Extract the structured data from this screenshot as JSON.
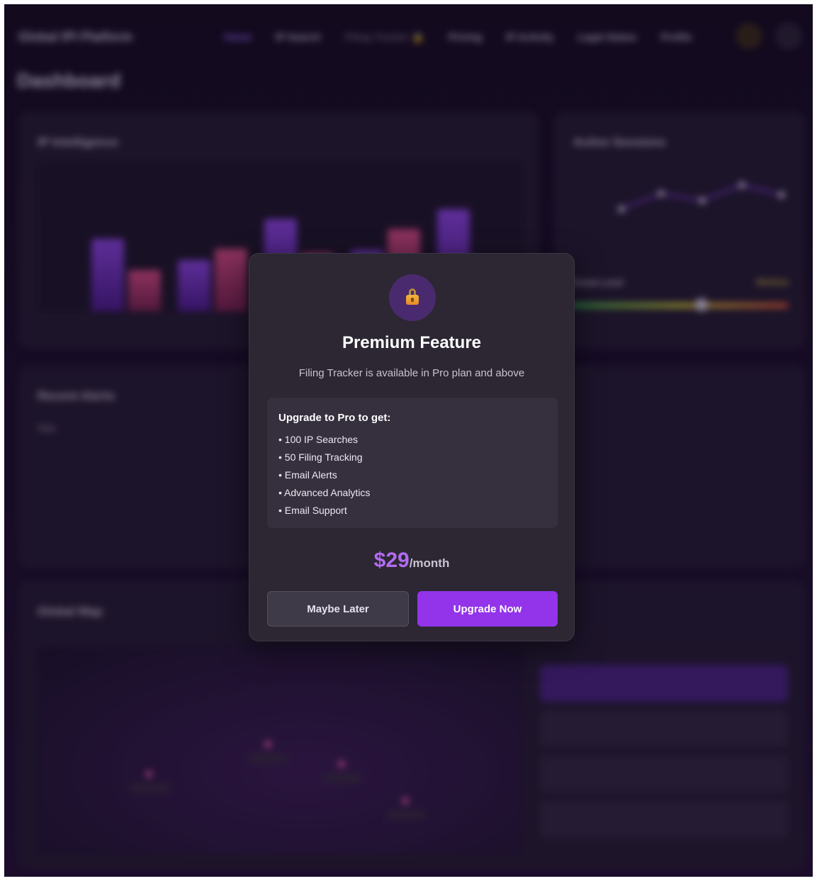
{
  "app": {
    "brand": "Global IPI Platform",
    "nav": [
      "Home",
      "IP Search",
      "Filing Tracker 🔒",
      "Pricing",
      "IP Activity",
      "Legal Status",
      "Profile"
    ],
    "page_title": "Dashboard"
  },
  "cards": {
    "ip_intelligence": "IP Intelligence",
    "active_sessions": "Active Sessions",
    "threat_level": "Threat Level",
    "threat_value": "Medium",
    "recent_alerts": "Recent Alerts",
    "alerts_time_header": "Time",
    "global_map": "Global Map"
  },
  "modal": {
    "icon": "lock-icon",
    "title": "Premium Feature",
    "subtitle": "Filing Tracker is available in Pro plan and above",
    "benefits_title": "Upgrade to Pro to get:",
    "benefits": [
      "• 100 IP Searches",
      "• 50 Filing Tracking",
      "• Email Alerts",
      "• Advanced Analytics",
      "• Email Support"
    ],
    "price": "$29",
    "period": "/month",
    "secondary_button": "Maybe Later",
    "primary_button": "Upgrade Now",
    "accent_color": "#9333ea"
  }
}
